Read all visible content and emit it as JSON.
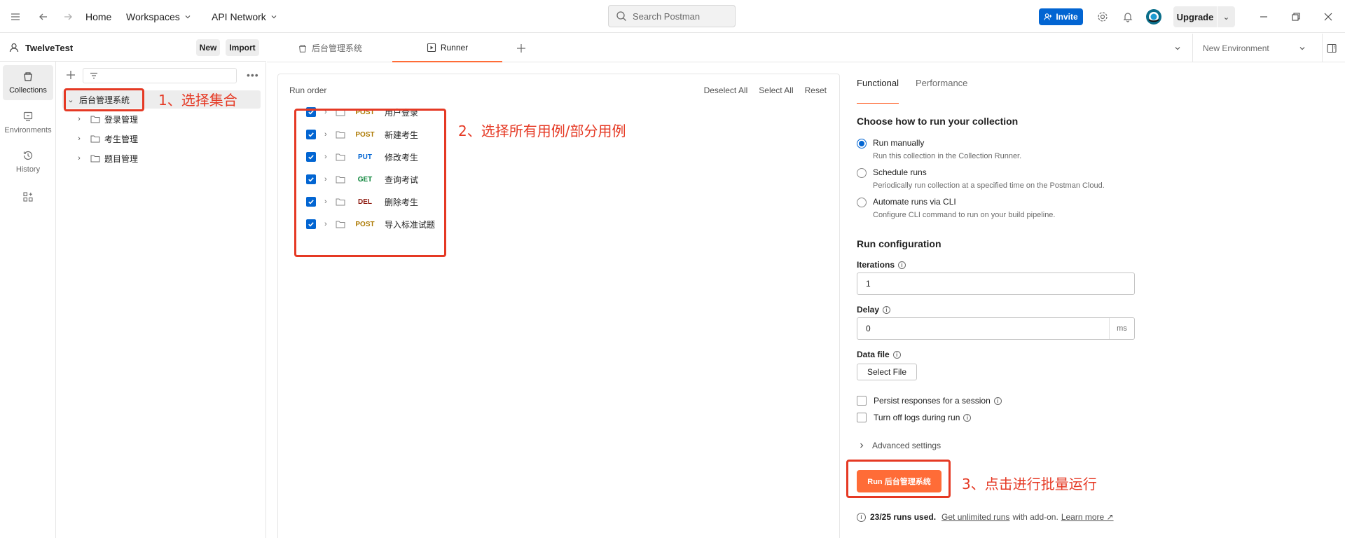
{
  "topbar": {
    "home": "Home",
    "workspaces": "Workspaces",
    "api_network": "API Network",
    "search_placeholder": "Search Postman",
    "invite": "Invite",
    "upgrade": "Upgrade"
  },
  "workspace": {
    "name": "TwelveTest",
    "new_label": "New",
    "import_label": "Import"
  },
  "rail": {
    "collections": "Collections",
    "environments": "Environments",
    "history": "History"
  },
  "tree": {
    "root": "后台管理系统",
    "folders": [
      "登录管理",
      "考生管理",
      "题目管理"
    ]
  },
  "tabs": {
    "collection_tab": "后台管理系统",
    "runner_tab": "Runner",
    "environment": "New Environment"
  },
  "run_order": {
    "title": "Run order",
    "deselect_all": "Deselect All",
    "select_all": "Select All",
    "reset": "Reset",
    "requests": [
      {
        "method": "POST",
        "name": "用户登录",
        "color": "#ad7a03",
        "checked": true
      },
      {
        "method": "POST",
        "name": "新建考生",
        "color": "#ad7a03",
        "checked": true
      },
      {
        "method": "PUT",
        "name": "修改考生",
        "color": "#0265d2",
        "checked": true
      },
      {
        "method": "GET",
        "name": "查询考试",
        "color": "#007f31",
        "checked": true
      },
      {
        "method": "DEL",
        "name": "删除考生",
        "color": "#8e1a10",
        "checked": true
      },
      {
        "method": "POST",
        "name": "导入标准试题",
        "color": "#ad7a03",
        "checked": true
      }
    ]
  },
  "annotations": {
    "step1": "1、选择集合",
    "step2": "2、选择所有用例/部分用例",
    "step3": "3、点击进行批量运行",
    "color": "#e53924"
  },
  "config": {
    "tab_functional": "Functional",
    "tab_performance": "Performance",
    "how_title": "Choose how to run your collection",
    "options": [
      {
        "label": "Run manually",
        "desc": "Run this collection in the Collection Runner.",
        "selected": true
      },
      {
        "label": "Schedule runs",
        "desc": "Periodically run collection at a specified time on the Postman Cloud.",
        "selected": false
      },
      {
        "label": "Automate runs via CLI",
        "desc": "Configure CLI command to run on your build pipeline.",
        "selected": false
      }
    ],
    "run_config_title": "Run configuration",
    "iterations_label": "Iterations",
    "iterations_value": "1",
    "delay_label": "Delay",
    "delay_value": "0",
    "delay_unit": "ms",
    "data_file_label": "Data file",
    "select_file": "Select File",
    "persist_label": "Persist responses for a session",
    "turn_off_logs_label": "Turn off logs during run",
    "advanced": "Advanced settings",
    "run_button": "Run 后台管理系统",
    "runs_used": "23/25 runs used.",
    "get_unlimited": "Get unlimited runs",
    "with_addon": "with add-on.",
    "learn_more": "Learn more ↗"
  },
  "colors": {
    "accent": "#ff6c37",
    "brand_blue": "#0265d2"
  }
}
